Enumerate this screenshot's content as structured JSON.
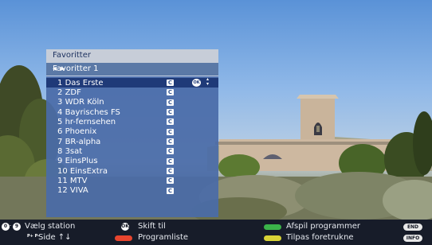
{
  "panel": {
    "title": "Favoritter",
    "list_name": "Favoritter 1",
    "list_nav_icon": "left-right-arrows-icon",
    "channels": [
      {
        "number": "1",
        "name": "Das Erste",
        "badge": "C",
        "selected": true
      },
      {
        "number": "2",
        "name": "ZDF",
        "badge": "C"
      },
      {
        "number": "3",
        "name": "WDR Köln",
        "badge": "C"
      },
      {
        "number": "4",
        "name": "Bayrisches FS",
        "badge": "C"
      },
      {
        "number": "5",
        "name": "hr-fernsehen",
        "badge": "C"
      },
      {
        "number": "6",
        "name": "Phoenix",
        "badge": "C"
      },
      {
        "number": "7",
        "name": "BR-alpha",
        "badge": "C"
      },
      {
        "number": "8",
        "name": "3sat",
        "badge": "C"
      },
      {
        "number": "9",
        "name": "EinsPlus",
        "badge": "C"
      },
      {
        "number": "10",
        "name": "EinsExtra",
        "badge": "C"
      },
      {
        "number": "11",
        "name": "MTV",
        "badge": "C"
      },
      {
        "number": "12",
        "name": "VIVA",
        "badge": "C"
      }
    ],
    "selected_ok": "OK",
    "selected_updown": "▴▾"
  },
  "footer": {
    "digits_from": "0",
    "digits_to": "9",
    "choose_station": "Vælg station",
    "pp_key": "P+ P–",
    "page": "Side ↑↓",
    "ok_key": "OK",
    "switch_to": "Skift til",
    "program_list": "Programliste",
    "play_programs": "Afspil programmer",
    "adjust_favorites": "Tilpas foretrukne",
    "end_key": "END",
    "info_key": "INFO"
  },
  "colors": {
    "red": "#e8452e",
    "green": "#3bb34a",
    "yellow": "#d8d336"
  }
}
